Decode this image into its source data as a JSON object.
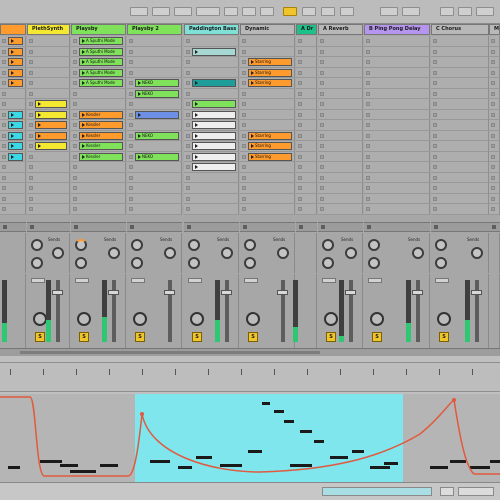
{
  "colors": {
    "orange": "#ff9a2c",
    "green": "#7fe25a",
    "cyan": "#3cd8e6",
    "yellow": "#f0c52c",
    "purple": "#b595ee",
    "loop_region": "#7ee6ec",
    "envelope": "#e05a40"
  },
  "tracks": [
    {
      "name": "",
      "header_color": "#ff9a2c"
    },
    {
      "name": "PlethSynth",
      "header_color": "#f5e830"
    },
    {
      "name": "Playsby",
      "header_color": "#7fe25a"
    },
    {
      "name": "Playsby 2",
      "header_color": "#7fe25a"
    },
    {
      "name": "Paddington Bass",
      "header_color": "#7fe0d6"
    },
    {
      "name": "Dynamic",
      "header_color": "#b8b8b8"
    },
    {
      "name": "A Dr",
      "header_color": "#1ec08a"
    },
    {
      "name": "A Reverb",
      "header_color": "#b8b8b8"
    },
    {
      "name": "B Ping Pong Delay",
      "header_color": "#b595ee"
    },
    {
      "name": "C Chorus",
      "header_color": "#b8b8b8"
    },
    {
      "name": "Ma",
      "header_color": "#b8b8b8"
    }
  ],
  "clips": [
    {
      "track": 0,
      "slot": 0,
      "text": "",
      "color": "#ff9a2c"
    },
    {
      "track": 0,
      "slot": 1,
      "text": "",
      "color": "#ff9a2c"
    },
    {
      "track": 0,
      "slot": 2,
      "text": "",
      "color": "#ff9a2c"
    },
    {
      "track": 0,
      "slot": 3,
      "text": "",
      "color": "#ff9a2c"
    },
    {
      "track": 0,
      "slot": 4,
      "text": "",
      "color": "#ff9a2c"
    },
    {
      "track": 0,
      "slot": 7,
      "text": "",
      "color": "#3cd8e6"
    },
    {
      "track": 0,
      "slot": 8,
      "text": "",
      "color": "#3cd8e6"
    },
    {
      "track": 0,
      "slot": 9,
      "text": "",
      "color": "#3cd8e6"
    },
    {
      "track": 0,
      "slot": 10,
      "text": "",
      "color": "#3cd8e6"
    },
    {
      "track": 0,
      "slot": 11,
      "text": "",
      "color": "#3cd8e6"
    },
    {
      "track": 1,
      "slot": 6,
      "text": "",
      "color": "#f5e830"
    },
    {
      "track": 1,
      "slot": 7,
      "text": "",
      "color": "#f5e830"
    },
    {
      "track": 1,
      "slot": 8,
      "text": "",
      "color": "#ff9a2c"
    },
    {
      "track": 1,
      "slot": 9,
      "text": "",
      "color": "#ff9a2c"
    },
    {
      "track": 1,
      "slot": 10,
      "text": "",
      "color": "#f5e830"
    },
    {
      "track": 2,
      "slot": 0,
      "text": "A Sputhi Mode",
      "color": "#7fe25a"
    },
    {
      "track": 2,
      "slot": 1,
      "text": "A Sputhi Mode",
      "color": "#7fe25a"
    },
    {
      "track": 2,
      "slot": 2,
      "text": "A Sputhi Mode",
      "color": "#7fe25a"
    },
    {
      "track": 2,
      "slot": 3,
      "text": "A Sputhi Mode",
      "color": "#7fe25a"
    },
    {
      "track": 2,
      "slot": 4,
      "text": "A Sputhi Mode",
      "color": "#7fe25a"
    },
    {
      "track": 2,
      "slot": 7,
      "text": "Kessler",
      "color": "#ff9a2c"
    },
    {
      "track": 2,
      "slot": 8,
      "text": "Kessler",
      "color": "#ff9a2c"
    },
    {
      "track": 2,
      "slot": 9,
      "text": "Kessler",
      "color": "#ff9a2c"
    },
    {
      "track": 2,
      "slot": 10,
      "text": "Kessler",
      "color": "#7fe25a"
    },
    {
      "track": 2,
      "slot": 11,
      "text": "Kessler",
      "color": "#7fe25a"
    },
    {
      "track": 3,
      "slot": 4,
      "text": "NEKO",
      "color": "#7fe25a"
    },
    {
      "track": 3,
      "slot": 5,
      "text": "NEKO",
      "color": "#7fe25a"
    },
    {
      "track": 3,
      "slot": 7,
      "text": "",
      "color": "#6d8fe6"
    },
    {
      "track": 3,
      "slot": 9,
      "text": "NEKO",
      "color": "#7fe25a"
    },
    {
      "track": 3,
      "slot": 11,
      "text": "NEKO",
      "color": "#7fe25a"
    },
    {
      "track": 4,
      "slot": 1,
      "text": "",
      "color": "#a7d7d2"
    },
    {
      "track": 4,
      "slot": 4,
      "text": "",
      "color": "#1e9e9a"
    },
    {
      "track": 4,
      "slot": 6,
      "text": "",
      "color": "#7fe25a"
    },
    {
      "track": 4,
      "slot": 7,
      "text": "",
      "color": "#eeeeee"
    },
    {
      "track": 4,
      "slot": 8,
      "text": "",
      "color": "#eeeeee"
    },
    {
      "track": 4,
      "slot": 9,
      "text": "",
      "color": "#eeeeee"
    },
    {
      "track": 4,
      "slot": 10,
      "text": "",
      "color": "#eeeeee"
    },
    {
      "track": 4,
      "slot": 11,
      "text": "",
      "color": "#eeeeee"
    },
    {
      "track": 4,
      "slot": 12,
      "text": "",
      "color": "#eeeeee"
    },
    {
      "track": 5,
      "slot": 2,
      "text": "Starring",
      "color": "#ff9a2c"
    },
    {
      "track": 5,
      "slot": 3,
      "text": "Starring",
      "color": "#ff9a2c"
    },
    {
      "track": 5,
      "slot": 4,
      "text": "Starring",
      "color": "#ff9a2c"
    },
    {
      "track": 5,
      "slot": 9,
      "text": "Starring",
      "color": "#ff9a2c"
    },
    {
      "track": 5,
      "slot": 10,
      "text": "Starring",
      "color": "#ff9a2c"
    },
    {
      "track": 5,
      "slot": 11,
      "text": "Starring",
      "color": "#ff9a2c"
    }
  ],
  "send_label": "Sends",
  "solo_label": "S",
  "meters": [
    {
      "track": 0,
      "level": 0.3
    },
    {
      "track": 1,
      "level": 0.35
    },
    {
      "track": 2,
      "level": 0.4
    },
    {
      "track": 4,
      "level": 0.35
    },
    {
      "track": 6,
      "level": 0.25
    },
    {
      "track": 7,
      "level": 0.1
    },
    {
      "track": 8,
      "level": 0.3
    },
    {
      "track": 9,
      "level": 0.35
    }
  ]
}
